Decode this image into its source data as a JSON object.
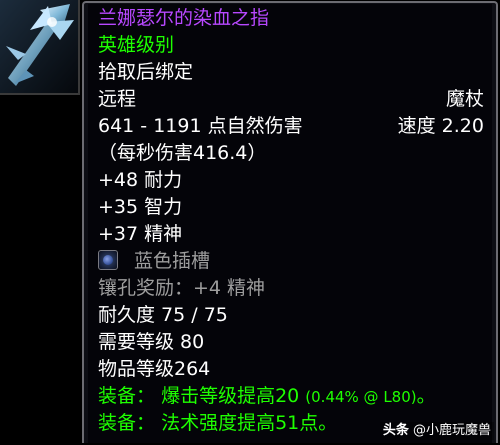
{
  "item": {
    "icon": "staff-icon",
    "name": "兰娜瑟尔的染血之指",
    "quality": "英雄级别",
    "bind": "拾取后绑定",
    "slot": "远程",
    "type": "魔杖",
    "damage": "641 - 1191 点自然伤害",
    "speed": "速度 2.20",
    "dps": "（每秒伤害416.4）",
    "stats": [
      "+48 耐力",
      "+35 智力",
      "+37 精神"
    ],
    "socket": "蓝色插槽",
    "socket_bonus": "镶孔奖励：+4 精神",
    "durability": "耐久度 75 / 75",
    "required_level": "需要等级 80",
    "item_level": "物品等级264",
    "equip1_prefix": "装备：",
    "equip1_text": "爆击等级提高20 ",
    "equip1_note": "(0.44% @ L80)",
    "equip1_end": "。",
    "equip2_prefix": "装备：",
    "equip2_text": "法术强度提高51点。"
  },
  "watermark": {
    "brand": "头条",
    "handle": " @小鹿玩魔兽"
  },
  "colors": {
    "epic": "#b848ff",
    "uncommon": "#1eff00",
    "grey": "#9d9d9d",
    "white": "#ffffff",
    "frame": "#6c6c72"
  }
}
